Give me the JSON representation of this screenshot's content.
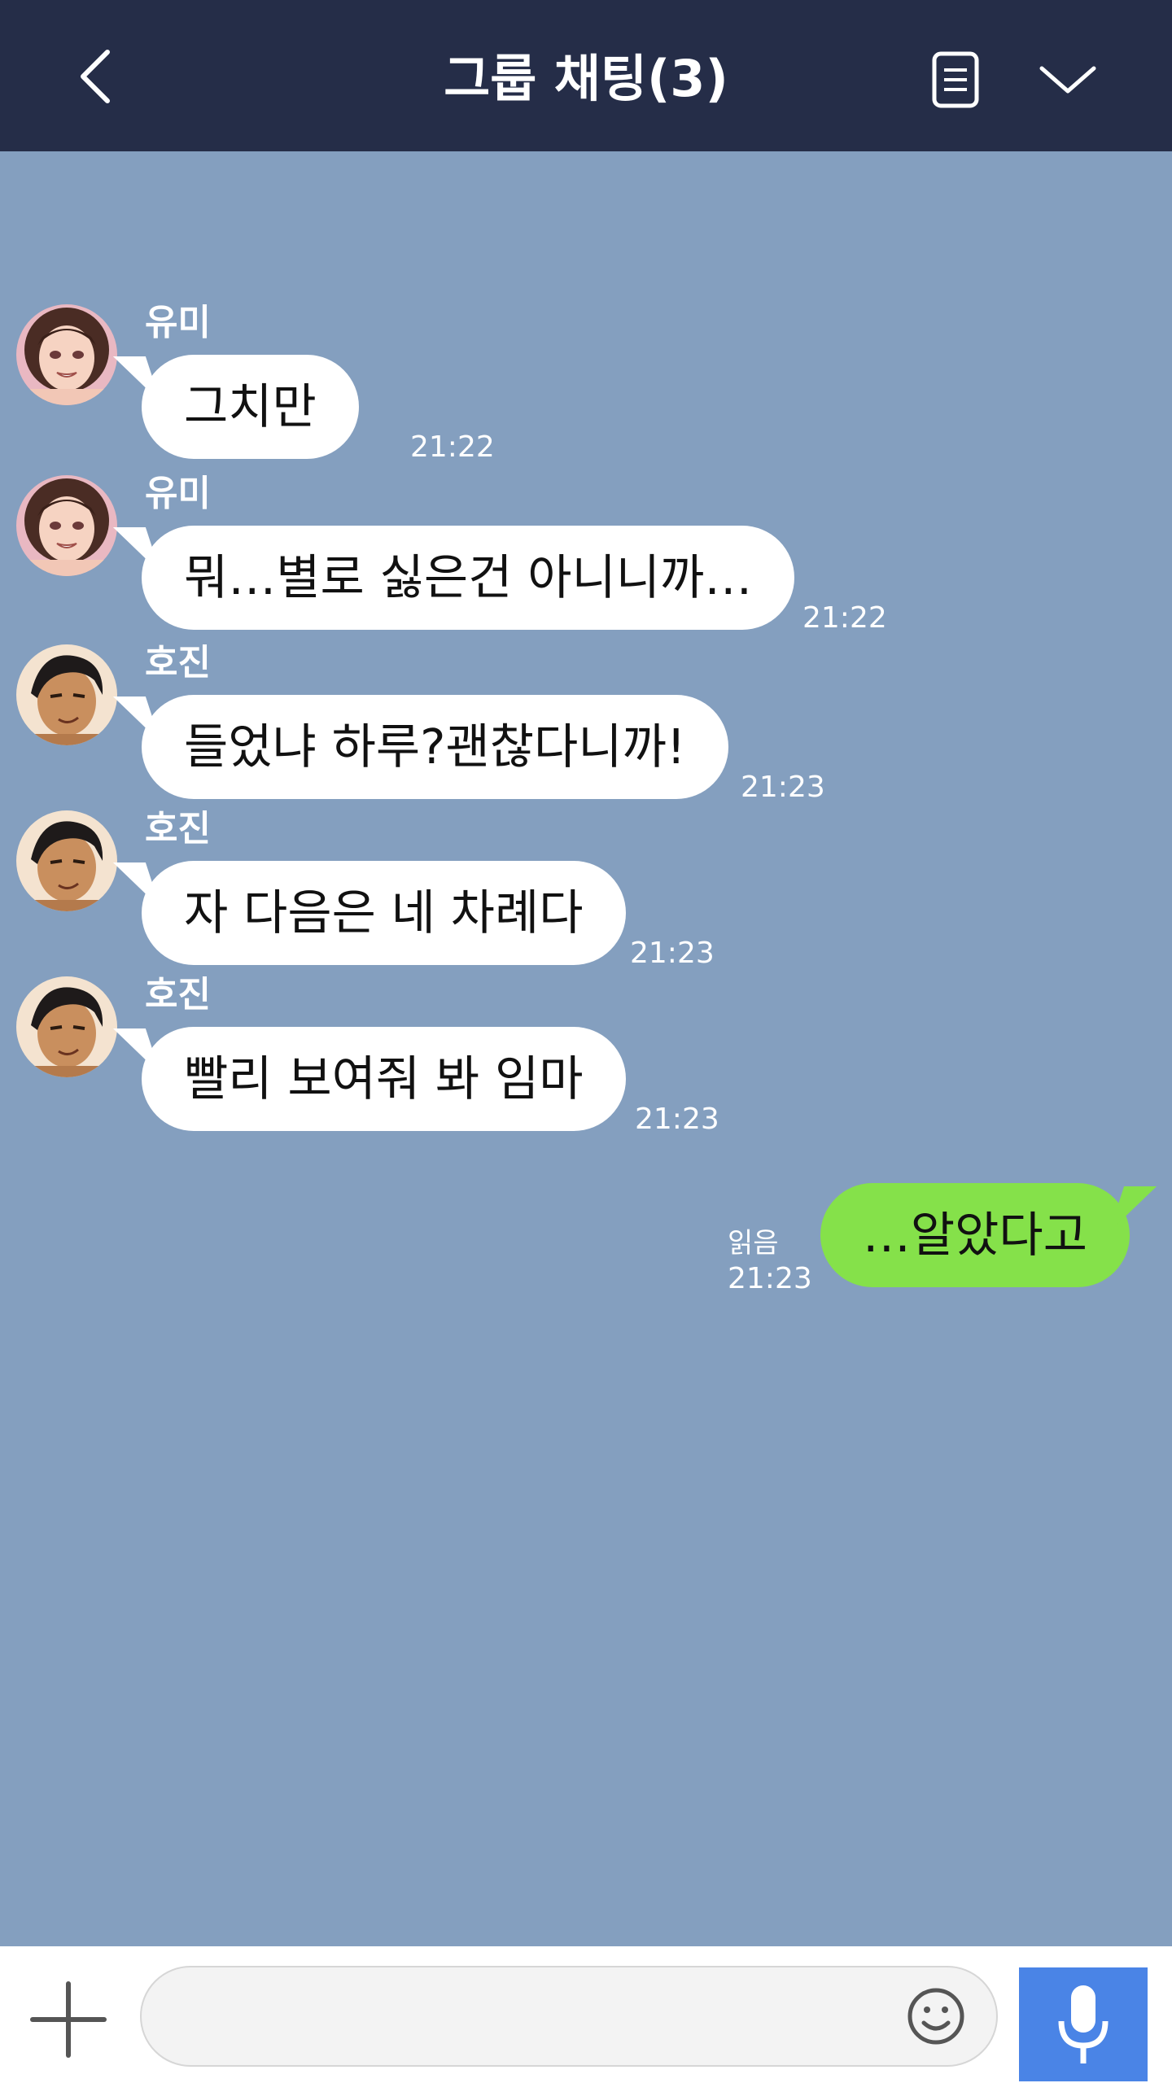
{
  "header": {
    "title": "그룹 채팅(3)",
    "back_icon": "chevron-left-icon",
    "notes_icon": "document-icon",
    "expand_icon": "chevron-down-icon",
    "background_color": "#252d48"
  },
  "chat": {
    "background_color": "#849fbf",
    "messages": [
      {
        "sender": "유미",
        "text": "그치만",
        "time": "21:22"
      },
      {
        "sender": "유미",
        "text": "뭐…별로 싫은건 아니니까…",
        "time": "21:22"
      },
      {
        "sender": "호진",
        "text": "들었냐 하루?괜찮다니까!",
        "time": "21:23"
      },
      {
        "sender": "호진",
        "text": "자 다음은 네 차례다",
        "time": "21:23"
      },
      {
        "sender": "호진",
        "text": "빨리 보여줘 봐 임마",
        "time": "21:23"
      }
    ],
    "outgoing": {
      "text": "…알았다고",
      "read_label": "읽음",
      "time": "21:23",
      "bubble_color": "#85e14a"
    }
  },
  "footer": {
    "plus_icon": "plus-icon",
    "input_value": "",
    "emoji_icon": "smiley-icon",
    "mic_icon": "microphone-icon",
    "mic_button_color": "#4a84e6"
  }
}
